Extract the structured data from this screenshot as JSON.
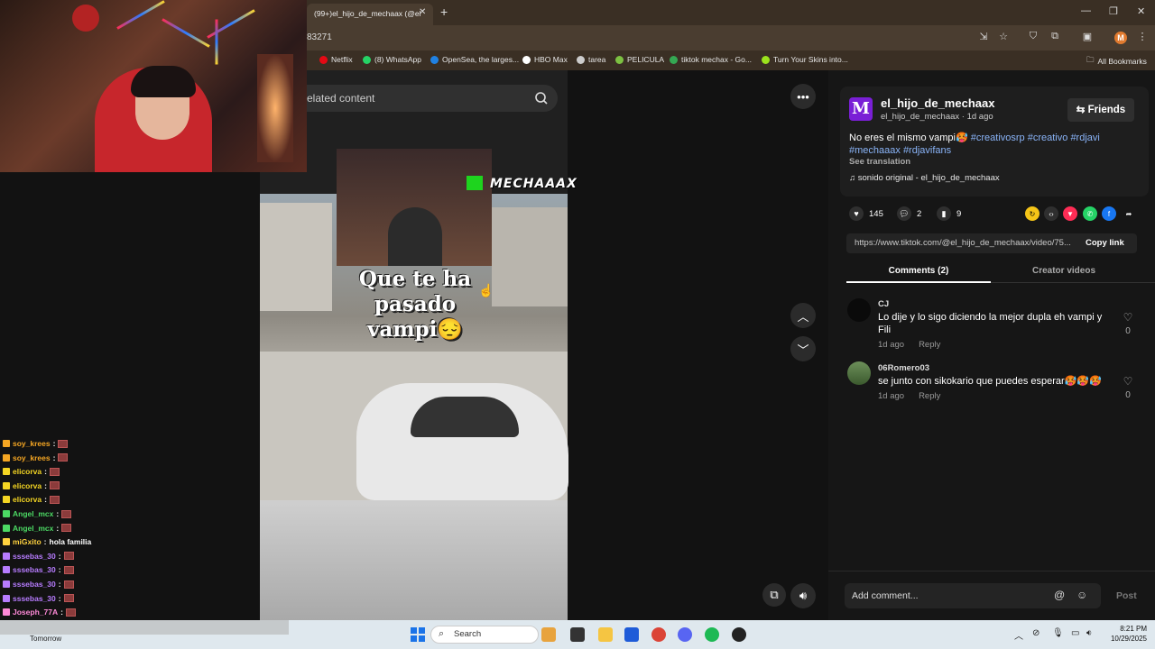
{
  "browser": {
    "tab_title": "(99+)el_hijo_de_mechaax (@el",
    "tab_close": "✕",
    "new_tab": "+",
    "url_partial": "83271",
    "bookmarks": [
      {
        "label": "Netflix",
        "color": "#e50914"
      },
      {
        "label": "(8) WhatsApp",
        "color": "#25d366"
      },
      {
        "label": "OpenSea, the larges...",
        "color": "#2081e2"
      },
      {
        "label": "HBO Max",
        "color": "#ffffff"
      },
      {
        "label": "tarea",
        "color": "#cccccc"
      },
      {
        "label": "PELICULA",
        "color": "#7cc142"
      },
      {
        "label": "tiktok mechax - Go...",
        "color": "#34a853"
      },
      {
        "label": "Turn Your Skins into...",
        "color": "#9be21d"
      }
    ],
    "all_bookmarks": "All Bookmarks",
    "profile_initial": "M"
  },
  "video": {
    "search_placeholder": "elated content",
    "watermark": "MECHAAAX",
    "caption_line1": "Que te ha",
    "caption_line2": "pasado",
    "caption_line3": "vampi😔"
  },
  "chat": [
    {
      "user": "soy_krees",
      "color": "#f5a623"
    },
    {
      "user": "soy_krees",
      "color": "#f5a623"
    },
    {
      "user": "elicorva",
      "color": "#f5d623"
    },
    {
      "user": "elicorva",
      "color": "#f5d623"
    },
    {
      "user": "elicorva",
      "color": "#f5d623"
    },
    {
      "user": "Angel_mcx",
      "color": "#4cd964"
    },
    {
      "user": "Angel_mcx",
      "color": "#4cd964"
    },
    {
      "user": "miGxito",
      "color": "#ffd23f",
      "msg": "hola familia"
    },
    {
      "user": "sssebas_30",
      "color": "#b77cff"
    },
    {
      "user": "sssebas_30",
      "color": "#b77cff"
    },
    {
      "user": "sssebas_30",
      "color": "#b77cff"
    },
    {
      "user": "sssebas_30",
      "color": "#b77cff"
    },
    {
      "user": "Joseph_77A",
      "color": "#ff8ad8"
    }
  ],
  "post": {
    "avatar_letter": "M",
    "username": "el_hijo_de_mechaax",
    "subline": "el_hijo_de_mechaax · 1d ago",
    "friends_label": "Friends",
    "desc_text": "No eres el mismo vampi🥵",
    "tags": [
      "#creativosrp",
      "#creativo",
      "#rdjavi",
      "#mechaaax",
      "#rdjavifans"
    ],
    "see_translation": "See translation",
    "sound": "sonido original - el_hijo_de_mechaax",
    "likes": "145",
    "comments": "2",
    "saves": "9",
    "link": "https://www.tiktok.com/@el_hijo_de_mechaax/video/75...",
    "copy_link": "Copy link",
    "tab_comments": "Comments (2)",
    "tab_creator": "Creator videos"
  },
  "comments": [
    {
      "user": "CJ",
      "text": "Lo dije y lo sigo diciendo la mejor dupla eh vampi y Fili",
      "time": "1d ago",
      "reply": "Reply",
      "likes": "0"
    },
    {
      "user": "06Romero03",
      "text": "se junto con sikokario que puedes esperar🥵🥵🥵",
      "time": "1d ago",
      "reply": "Reply",
      "likes": "0"
    }
  ],
  "comment_box": {
    "placeholder": "Add comment...",
    "post": "Post"
  },
  "taskbar": {
    "search": "Search",
    "time": "8:21 PM",
    "date": "10/29/2025",
    "weather": "Tomorrow"
  }
}
